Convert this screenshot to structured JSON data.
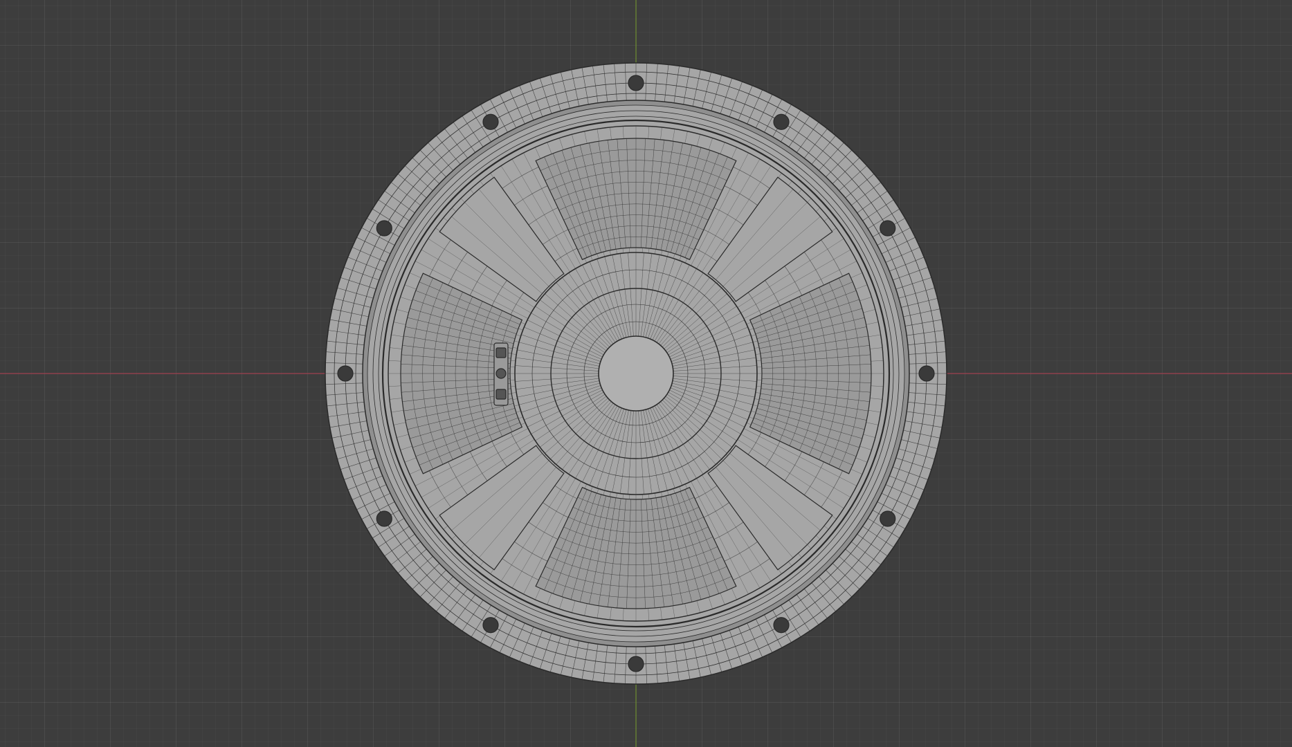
{
  "viewport": {
    "view": "top-orthographic",
    "mode": "wireframe-on-solid",
    "grid": true,
    "colors": {
      "background": "#3d3d3d",
      "x_axis": "#9b3d4b",
      "y_axis": "#6a8a2c",
      "surface": "#a6a6a6",
      "surface_dark": "#8f8f8f",
      "wire": "#2a2a2a"
    }
  },
  "object": {
    "type": "loudspeaker-driver",
    "mounting_holes": 12,
    "spokes": 4,
    "windows": 4,
    "terminal": "solder-terminal-icon"
  }
}
